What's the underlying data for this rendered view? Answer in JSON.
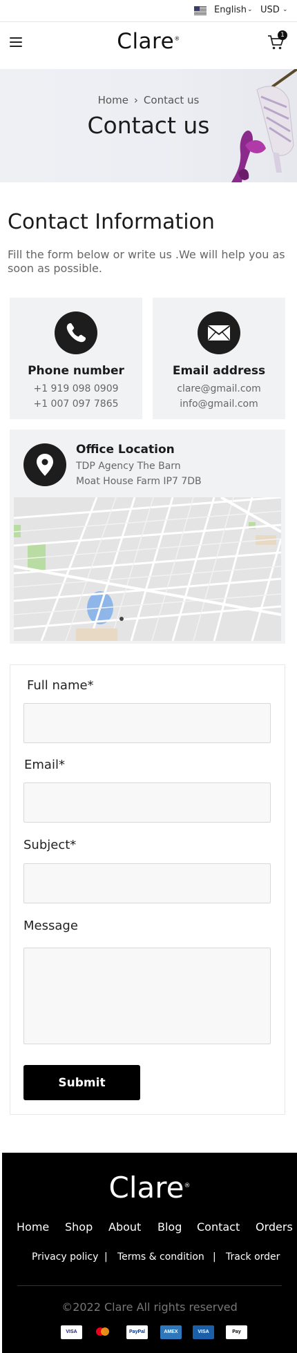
{
  "topbar": {
    "language": "English",
    "currency": "USD"
  },
  "header": {
    "logo": "Clare",
    "logo_mark": "®",
    "cart_count": "1"
  },
  "hero": {
    "breadcrumb_home": "Home",
    "breadcrumb_current": "Contact us",
    "title": "Contact us"
  },
  "contact_info": {
    "title": "Contact Information",
    "subtitle": "Fill the form below or write us .We will help you as soon as possible.",
    "phone": {
      "label": "Phone number",
      "lines": [
        "+1 919 098 0909",
        "+1 007 097 7865"
      ]
    },
    "email": {
      "label": "Email address",
      "lines": [
        "clare@gmail.com",
        "info@gmail.com"
      ]
    },
    "office": {
      "label": "Office Location",
      "lines": [
        "TDP Agency The Barn",
        "Moat House Farm IP7 7DB"
      ]
    }
  },
  "form": {
    "full_name_label": "Full name*",
    "email_label": "Email*",
    "subject_label": "Subject*",
    "message_label": "Message",
    "submit_label": "Submit"
  },
  "footer": {
    "logo": "Clare",
    "logo_mark": "®",
    "nav": [
      "Home",
      "Shop",
      "About",
      "Blog",
      "Contact",
      "Orders"
    ],
    "legal": [
      "Privacy policy",
      "|",
      "Terms & condition",
      "|",
      "Track order"
    ],
    "copyright": "©2022 Clare All rights reserved",
    "payment_icons": [
      "visa-icon",
      "mastercard-icon",
      "paypal-icon",
      "amex-icon",
      "visa-electron-icon",
      "apple-pay-icon"
    ]
  },
  "colors": {
    "accent": "#000000",
    "card_bg": "#f1f2f4",
    "footer_bg": "#000000"
  }
}
